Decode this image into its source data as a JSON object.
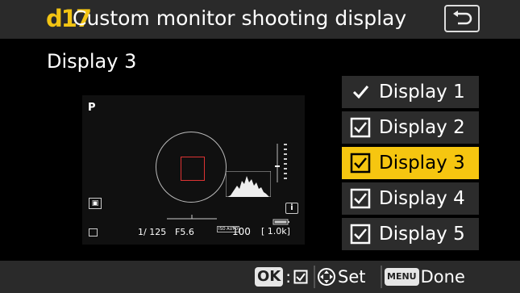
{
  "header": {
    "menu_code": "d17",
    "title": "Custom monitor shooting display",
    "back_icon": "return-arrow-icon"
  },
  "subtitle": "Display 3",
  "preview": {
    "mode": "P",
    "shutter": "1/ 125",
    "aperture": "F5.6",
    "iso_auto_label": "ISO AUTO",
    "iso": "100",
    "shots_remaining": "[ 1.0k]",
    "info_icon": "i"
  },
  "display_list": [
    {
      "label": "Display 1",
      "mark": "checkmark",
      "selected": false
    },
    {
      "label": "Display 2",
      "mark": "checked-box",
      "selected": false
    },
    {
      "label": "Display 3",
      "mark": "checked-box",
      "selected": true
    },
    {
      "label": "Display 4",
      "mark": "checked-box",
      "selected": false
    },
    {
      "label": "Display 5",
      "mark": "checked-box",
      "selected": false
    }
  ],
  "footer": {
    "ok_key": "OK",
    "set_label": "Set",
    "menu_key": "MENU",
    "done_label": "Done"
  },
  "colors": {
    "accent": "#f6c610",
    "menu_code": "#f2c413",
    "bar": "#2a2a2a",
    "item": "#2c2c2c"
  }
}
